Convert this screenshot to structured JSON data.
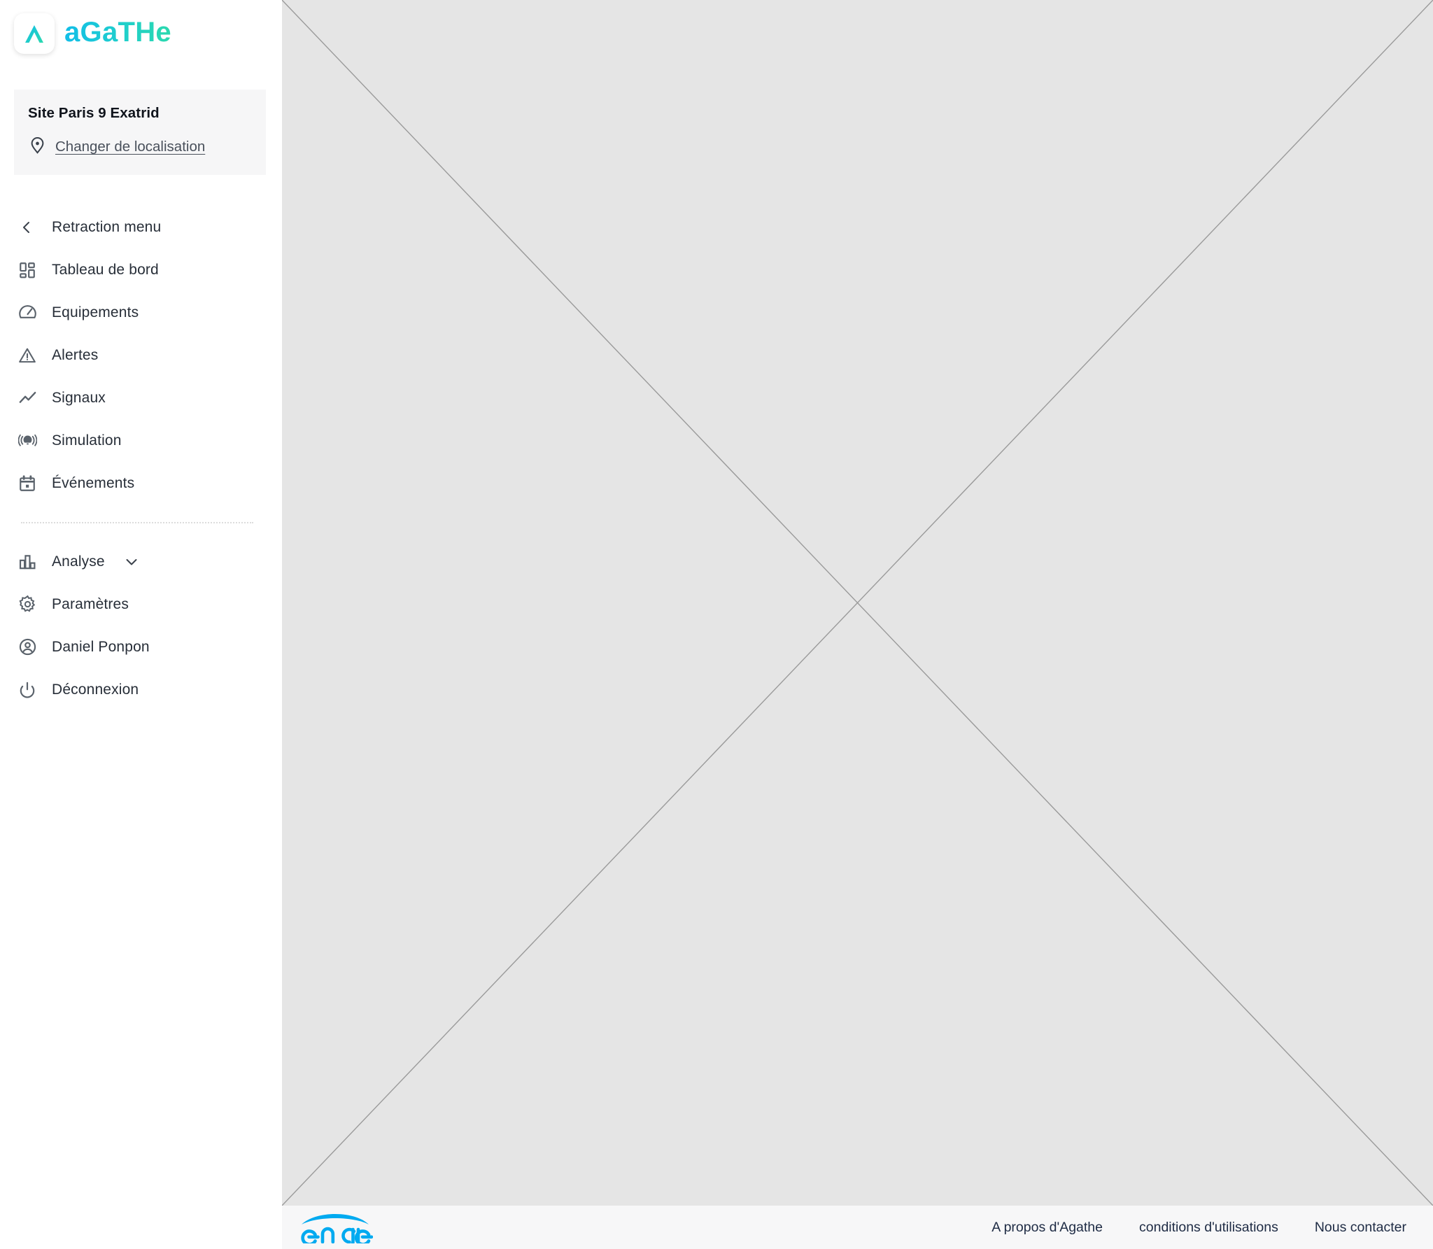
{
  "brand": {
    "name": "aGaTHe",
    "mark_glyph": "Λ",
    "gradient_from": "#12BEE8",
    "gradient_to": "#2BD9AE"
  },
  "location": {
    "site_name": "Site Paris 9 Exatrid",
    "change_link": "Changer de localisation",
    "pin_icon": "map-pin-icon"
  },
  "sidebar": {
    "collapse": {
      "label": "Retraction menu",
      "icon": "chevron-left-icon"
    },
    "items": [
      {
        "label": "Tableau de bord",
        "icon": "dashboard-grid-icon"
      },
      {
        "label": "Equipements",
        "icon": "gauge-icon"
      },
      {
        "label": "Alertes",
        "icon": "warning-triangle-icon"
      },
      {
        "label": "Signaux",
        "icon": "line-chart-icon"
      },
      {
        "label": "Simulation",
        "icon": "broadcast-icon"
      },
      {
        "label": "Événements",
        "icon": "calendar-icon"
      }
    ],
    "secondary_items": [
      {
        "label": "Analyse",
        "icon": "bar-chart-icon",
        "caret": "chevron-down-icon",
        "expandable": true
      },
      {
        "label": "Paramètres",
        "icon": "gear-icon",
        "expandable": false
      },
      {
        "label": "Daniel Ponpon",
        "icon": "user-circle-icon",
        "expandable": false
      },
      {
        "label": "Déconnexion",
        "icon": "power-icon",
        "expandable": false
      }
    ]
  },
  "footer": {
    "engie_logo": "engie-logo",
    "engie_color": "#00AAF0",
    "links": [
      "A propos d'Agathe",
      "conditions d'utilisations",
      "Nous contacter"
    ]
  },
  "content": {
    "state": "empty-placeholder"
  }
}
